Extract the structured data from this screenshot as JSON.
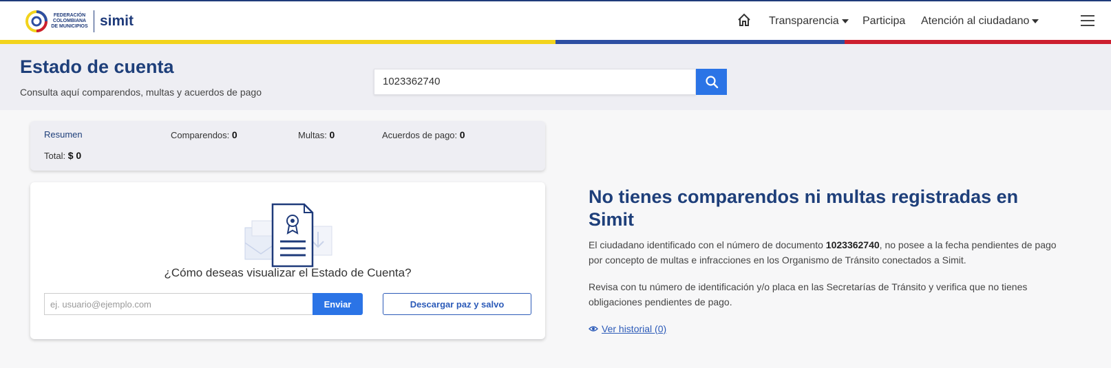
{
  "header": {
    "logo_fcm_lines": [
      "FEDERACIÓN",
      "COLOMBIANA",
      "DE MUNICIPIOS"
    ],
    "logo_simit": "simit",
    "nav": {
      "transparencia": "Transparencia",
      "participa": "Participa",
      "atencion": "Atención al ciudadano"
    },
    "stripe_colors": [
      "#f2d31c",
      "#2d4ea2",
      "#cc1f2f"
    ]
  },
  "band": {
    "title": "Estado de cuenta",
    "subtitle": "Consulta aquí comparendos, multas y acuerdos de pago",
    "search_value": "1023362740"
  },
  "summary": {
    "title": "Resumen",
    "comparendos_label": "Comparendos:",
    "comparendos_value": "0",
    "multas_label": "Multas:",
    "multas_value": "0",
    "acuerdos_label": "Acuerdos de pago:",
    "acuerdos_value": "0",
    "total_label": "Total:",
    "total_value": "$ 0"
  },
  "card": {
    "question": "¿Cómo deseas visualizar el Estado de Cuenta?",
    "email_placeholder": "ej. usuario@ejemplo.com",
    "send_label": "Enviar",
    "download_label": "Descargar paz y salvo"
  },
  "info": {
    "title": "No tienes comparendos ni multas registradas en Simit",
    "p1_prefix": "El ciudadano identificado con el número de documento ",
    "p1_doc": "1023362740",
    "p1_suffix": ", no posee a la fecha pendientes de pago por concepto de multas e infracciones en los Organismo de Tránsito conectados a Simit.",
    "p2": "Revisa con tu número de identificación y/o placa en las Secretarías de Tránsito y verifica que no tienes obligaciones pendientes de pago.",
    "history_link": "Ver historial (0)"
  },
  "accent_color": "#2b74e6",
  "title_color": "#1e3f7a"
}
